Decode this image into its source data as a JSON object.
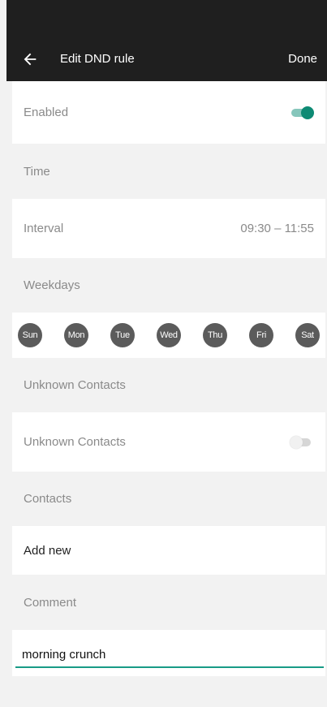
{
  "topbar": {
    "back_icon": "arrow-left-icon",
    "title": "Edit DND rule",
    "done_label": "Done"
  },
  "enabled": {
    "label": "Enabled",
    "state": "on"
  },
  "time": {
    "header": "Time",
    "interval_label": "Interval",
    "interval_value": "09:30 – 11:55"
  },
  "weekdays": {
    "header": "Weekdays",
    "days": [
      "Sun",
      "Mon",
      "Tue",
      "Wed",
      "Thu",
      "Fri",
      "Sat"
    ]
  },
  "unknown_contacts": {
    "header": "Unknown Contacts",
    "label": "Unknown Contacts",
    "state": "off"
  },
  "contacts": {
    "header": "Contacts",
    "add_new": "Add new"
  },
  "comment": {
    "header": "Comment",
    "value": "morning crunch"
  },
  "colors": {
    "accent": "#0e8a74",
    "topbar": "#1f1f1f",
    "day_chip": "#5b5b5b",
    "background": "#f2f2f2"
  }
}
